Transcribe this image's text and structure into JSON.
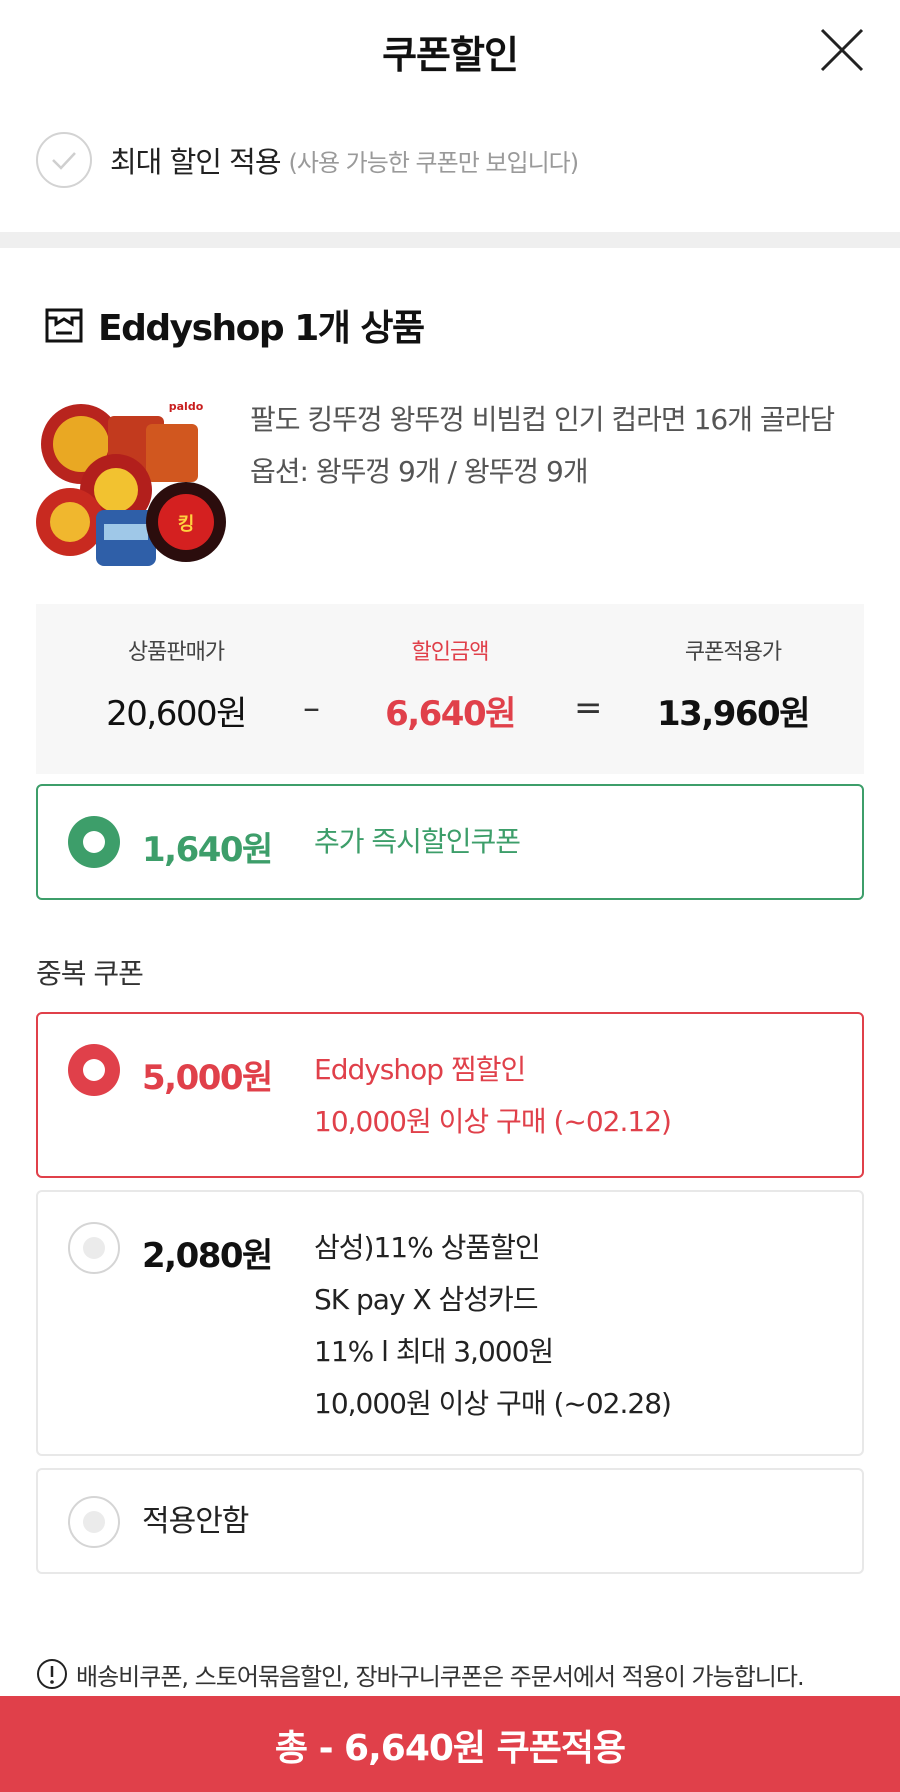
{
  "header": {
    "title": "쿠폰할인"
  },
  "max_discount": {
    "label": "최대 할인 적용",
    "note": "(사용 가능한 쿠폰만 보입니다)"
  },
  "shop": {
    "name": "Eddyshop 1개 상품"
  },
  "product": {
    "title": "팔도 킹뚜껑 왕뚜껑 비빔컵 인기 컵라면 16개 골라담",
    "option": "옵션: 왕뚜껑 9개 / 왕뚜껑 9개",
    "image_brand": "paldo"
  },
  "price_summary": {
    "sale_label": "상품판매가",
    "sale_value": "20,600원",
    "minus": "–",
    "discount_label": "할인금액",
    "discount_value": "6,640원",
    "equals": "=",
    "final_label": "쿠폰적용가",
    "final_value": "13,960원"
  },
  "instant_coupon": {
    "amount": "1,640원",
    "label": "추가 즉시할인쿠폰"
  },
  "duplicate_section": {
    "label": "중복 쿠폰",
    "coupons": [
      {
        "amount": "5,000원",
        "lines": [
          "Eddyshop 찜할인",
          "10,000원 이상 구매 (~02.12)"
        ],
        "selected": true
      },
      {
        "amount": "2,080원",
        "lines": [
          "삼성)11% 상품할인",
          "SK pay X 삼성카드",
          "11% l 최대 3,000원",
          "10,000원 이상 구매 (~02.28)"
        ],
        "selected": false
      }
    ],
    "none_option": {
      "label": "적용안함",
      "selected": false
    }
  },
  "notice": "배송비쿠폰, 스토어묶음할인, 장바구니쿠폰은 주문서에서 적용이 가능합니다.",
  "apply_button": {
    "label": "총 - 6,640원 쿠폰적용"
  },
  "colors": {
    "accent_red": "#e0404a",
    "accent_green": "#3d9e6a",
    "border_gray": "#e2e2e2"
  }
}
